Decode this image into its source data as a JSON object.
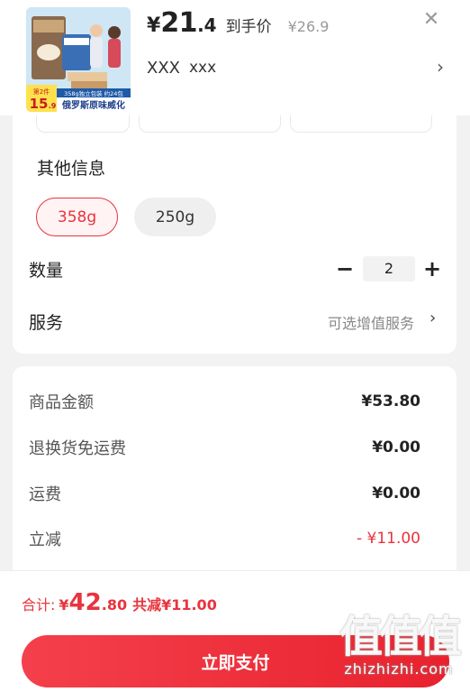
{
  "header": {
    "price_yen": "¥",
    "price_int": "21",
    "price_dec": ".4",
    "price_label": "到手价",
    "original_price": "¥26.9",
    "spec_main": "XXX",
    "spec_sub": "xxx",
    "close_icon": "close-icon",
    "chevron_icon": "chevron-right-icon"
  },
  "product_image": {
    "badge_top": "第2件",
    "badge_price": "15",
    "badge_price_dec": ".9",
    "pack_caption": "358g独立包装 约24包",
    "banner_text": "俄罗斯原味威化"
  },
  "other_info": {
    "title": "其他信息",
    "options": [
      {
        "label": "358g",
        "selected": true
      },
      {
        "label": "250g",
        "selected": false
      }
    ]
  },
  "quantity": {
    "label": "数量",
    "minus": "−",
    "value": "2",
    "plus": "+"
  },
  "service": {
    "label": "服务",
    "hint": "可选增值服务",
    "chevron": "›"
  },
  "breakdown": [
    {
      "label": "商品金额",
      "value": "¥53.80"
    },
    {
      "label": "退换货免运费",
      "value": "¥0.00"
    },
    {
      "label": "运费",
      "value": "¥0.00"
    },
    {
      "label": "立减",
      "value": "- ¥11.00"
    }
  ],
  "footer": {
    "total_label": "合计:",
    "total_yen": "¥",
    "total_int": "42",
    "total_dec": ".80",
    "discount_text": "共减¥11.00",
    "pay_button": "立即支付"
  },
  "watermark": {
    "glyphs": "值值值",
    "site": "zhizhizhi.com"
  },
  "colors": {
    "accent": "#e8343e",
    "button_gradient_start": "#f4404c",
    "button_gradient_end": "#e8222e"
  }
}
